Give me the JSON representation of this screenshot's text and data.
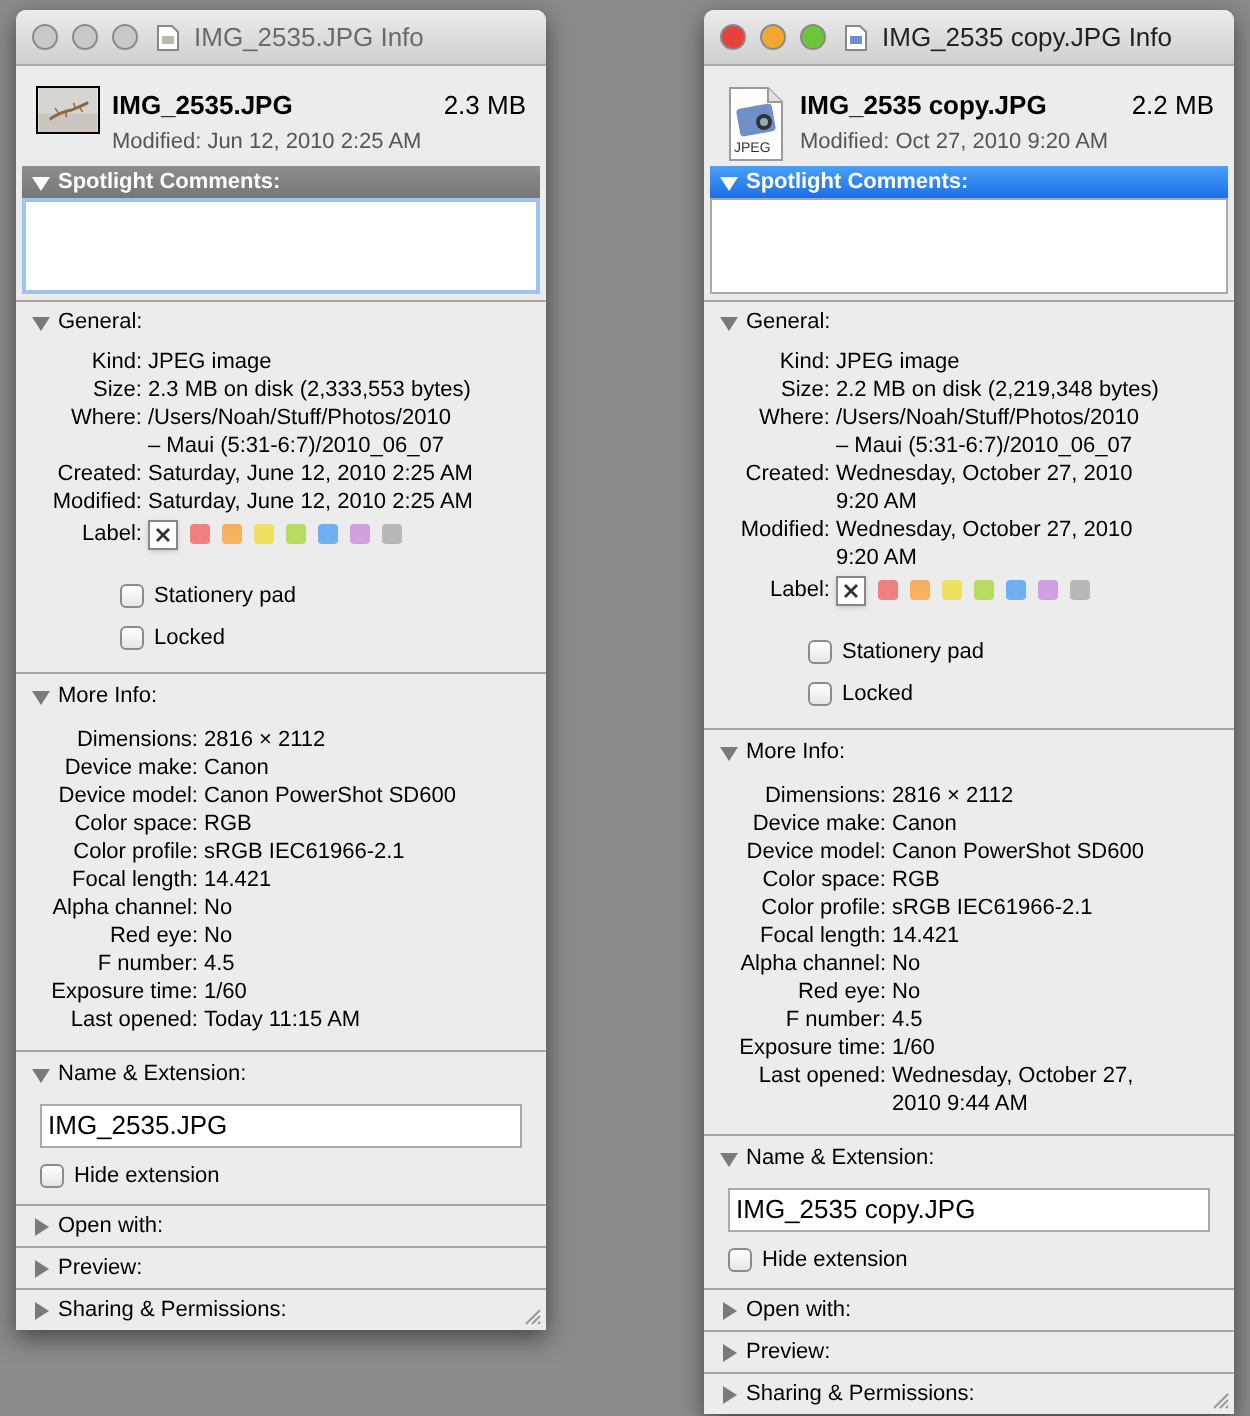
{
  "windows": [
    {
      "active": false,
      "title": "IMG_2535.JPG Info",
      "file_icon": {
        "kind": "thumbnail"
      },
      "file_name": "IMG_2535.JPG",
      "file_size": "2.3 MB",
      "modified": "Modified: Jun 12, 2010 2:25 AM",
      "spotlight": {
        "label": "Spotlight Comments:",
        "expanded": true,
        "highlighted": false
      },
      "general": {
        "label": "General:",
        "expanded": true,
        "rows": [
          {
            "key": "Kind:",
            "lines": [
              "JPEG image"
            ]
          },
          {
            "key": "Size:",
            "lines": [
              "2.3 MB on disk (2,333,553 bytes)"
            ]
          },
          {
            "key": "Where:",
            "lines": [
              "/Users/Noah/Stuff/Photos/2010",
              "– Maui (5:31-6:7)/2010_06_07"
            ]
          },
          {
            "key": "Created:",
            "lines": [
              "Saturday, June 12, 2010 2:25 AM"
            ]
          },
          {
            "key": "Modified:",
            "lines": [
              "Saturday, June 12, 2010 2:25 AM"
            ]
          }
        ],
        "label_key": "Label:",
        "labels": [
          {
            "kind": "none",
            "selected": true
          },
          {
            "kind": "color",
            "color": "#f08080",
            "selected": false
          },
          {
            "kind": "color",
            "color": "#f5b060",
            "selected": false
          },
          {
            "kind": "color",
            "color": "#f0e060",
            "selected": false
          },
          {
            "kind": "color",
            "color": "#b8dc60",
            "selected": false
          },
          {
            "kind": "color",
            "color": "#70b0f0",
            "selected": false
          },
          {
            "kind": "color",
            "color": "#d0a0e0",
            "selected": false
          },
          {
            "kind": "color",
            "color": "#b8b8b8",
            "selected": false
          }
        ],
        "checkboxes": [
          {
            "label": "Stationery pad",
            "checked": false
          },
          {
            "label": "Locked",
            "checked": false
          }
        ]
      },
      "more_info": {
        "label": "More Info:",
        "expanded": true,
        "rows": [
          {
            "key": "Dimensions:",
            "lines": [
              "2816 × 2112"
            ]
          },
          {
            "key": "Device make:",
            "lines": [
              "Canon"
            ]
          },
          {
            "key": "Device model:",
            "lines": [
              "Canon PowerShot SD600"
            ]
          },
          {
            "key": "Color space:",
            "lines": [
              "RGB"
            ]
          },
          {
            "key": "Color profile:",
            "lines": [
              "sRGB IEC61966-2.1"
            ]
          },
          {
            "key": "Focal length:",
            "lines": [
              "14.421"
            ]
          },
          {
            "key": "Alpha channel:",
            "lines": [
              "No"
            ]
          },
          {
            "key": "Red eye:",
            "lines": [
              "No"
            ]
          },
          {
            "key": "F number:",
            "lines": [
              "4.5"
            ]
          },
          {
            "key": "Exposure time:",
            "lines": [
              "1/60"
            ]
          },
          {
            "key": "Last opened:",
            "lines": [
              "Today 11:15 AM"
            ]
          }
        ]
      },
      "name_extension": {
        "label": "Name & Extension:",
        "expanded": true,
        "value": "IMG_2535.JPG",
        "hide_extension": {
          "label": "Hide extension",
          "checked": false
        }
      },
      "collapsed": [
        {
          "label": "Open with:",
          "expanded": false
        },
        {
          "label": "Preview:",
          "expanded": false
        },
        {
          "label": "Sharing & Permissions:",
          "expanded": false
        }
      ]
    },
    {
      "active": true,
      "title": "IMG_2535 copy.JPG Info",
      "file_icon": {
        "kind": "document",
        "label": "JPEG"
      },
      "file_name": "IMG_2535 copy.JPG",
      "file_size": "2.2 MB",
      "modified": "Modified: Oct 27, 2010 9:20 AM",
      "spotlight": {
        "label": "Spotlight Comments:",
        "expanded": true,
        "highlighted": true
      },
      "general": {
        "label": "General:",
        "expanded": true,
        "rows": [
          {
            "key": "Kind:",
            "lines": [
              "JPEG image"
            ]
          },
          {
            "key": "Size:",
            "lines": [
              "2.2 MB on disk (2,219,348 bytes)"
            ]
          },
          {
            "key": "Where:",
            "lines": [
              "/Users/Noah/Stuff/Photos/2010",
              "– Maui (5:31-6:7)/2010_06_07"
            ]
          },
          {
            "key": "Created:",
            "lines": [
              "Wednesday, October 27, 2010",
              "9:20 AM"
            ]
          },
          {
            "key": "Modified:",
            "lines": [
              "Wednesday, October 27, 2010",
              "9:20 AM"
            ]
          }
        ],
        "label_key": "Label:",
        "labels": [
          {
            "kind": "none",
            "selected": true
          },
          {
            "kind": "color",
            "color": "#f08080",
            "selected": false
          },
          {
            "kind": "color",
            "color": "#f5b060",
            "selected": false
          },
          {
            "kind": "color",
            "color": "#f0e060",
            "selected": false
          },
          {
            "kind": "color",
            "color": "#b8dc60",
            "selected": false
          },
          {
            "kind": "color",
            "color": "#70b0f0",
            "selected": false
          },
          {
            "kind": "color",
            "color": "#d0a0e0",
            "selected": false
          },
          {
            "kind": "color",
            "color": "#b8b8b8",
            "selected": false
          }
        ],
        "checkboxes": [
          {
            "label": "Stationery pad",
            "checked": false
          },
          {
            "label": "Locked",
            "checked": false
          }
        ]
      },
      "more_info": {
        "label": "More Info:",
        "expanded": true,
        "rows": [
          {
            "key": "Dimensions:",
            "lines": [
              "2816 × 2112"
            ]
          },
          {
            "key": "Device make:",
            "lines": [
              "Canon"
            ]
          },
          {
            "key": "Device model:",
            "lines": [
              "Canon PowerShot SD600"
            ]
          },
          {
            "key": "Color space:",
            "lines": [
              "RGB"
            ]
          },
          {
            "key": "Color profile:",
            "lines": [
              "sRGB IEC61966-2.1"
            ]
          },
          {
            "key": "Focal length:",
            "lines": [
              "14.421"
            ]
          },
          {
            "key": "Alpha channel:",
            "lines": [
              "No"
            ]
          },
          {
            "key": "Red eye:",
            "lines": [
              "No"
            ]
          },
          {
            "key": "F number:",
            "lines": [
              "4.5"
            ]
          },
          {
            "key": "Exposure time:",
            "lines": [
              "1/60"
            ]
          },
          {
            "key": "Last opened:",
            "lines": [
              "Wednesday, October 27,",
              "2010 9:44 AM"
            ]
          }
        ]
      },
      "name_extension": {
        "label": "Name & Extension:",
        "expanded": true,
        "value": "IMG_2535 copy.JPG",
        "hide_extension": {
          "label": "Hide extension",
          "checked": false
        }
      },
      "collapsed": [
        {
          "label": "Open with:",
          "expanded": false
        },
        {
          "label": "Preview:",
          "expanded": false
        },
        {
          "label": "Sharing & Permissions:",
          "expanded": false
        }
      ]
    }
  ]
}
